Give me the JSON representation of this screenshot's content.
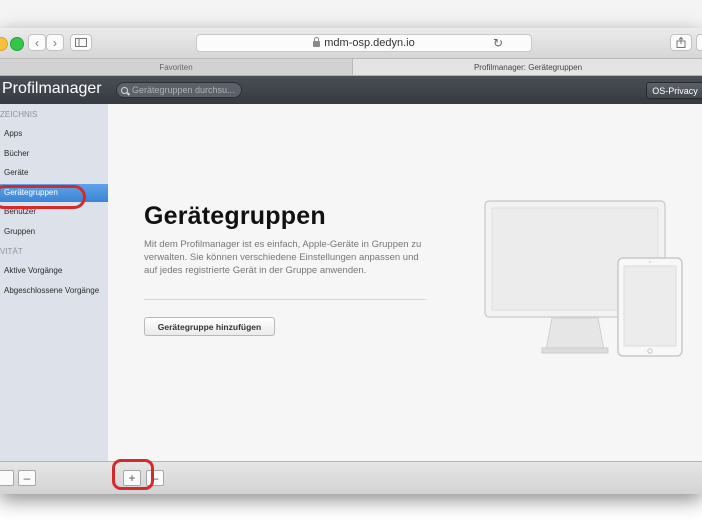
{
  "browser": {
    "address": "mdm-osp.dedyn.io",
    "tabs": [
      "Favoriten",
      "Profilmanager: Gerätegruppen"
    ]
  },
  "app": {
    "title": "Profilmanager",
    "search_placeholder": "Gerätegruppen durchsu...",
    "org_button": "OS-Privacy"
  },
  "sidebar": {
    "section_library": "ZEICHNIS",
    "section_activity": "VITÄT",
    "items": [
      "Apps",
      "Bücher",
      "Geräte",
      "Gerätegruppen",
      "Benutzer",
      "Gruppen"
    ],
    "activity_items": [
      "Aktive Vorgänge",
      "Abgeschlossene Vorgänge"
    ]
  },
  "main": {
    "title": "Gerätegruppen",
    "description": "Mit dem Profilmanager ist es einfach, Apple-Geräte in Gruppen zu verwalten. Sie können verschiedene Einstellungen anpassen und auf jedes registrierte Gerät in der Gruppe anwenden.",
    "add_button": "Gerätegruppe hinzufügen"
  },
  "footer": {
    "add_label": "+",
    "remove_label": "–"
  }
}
